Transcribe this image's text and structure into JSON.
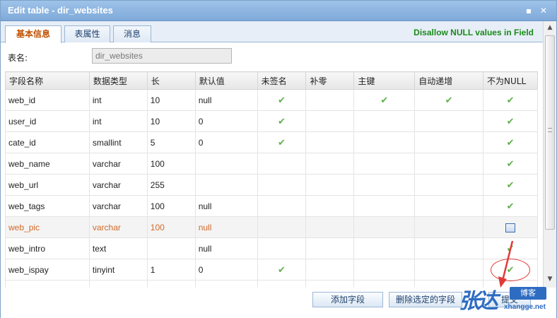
{
  "window": {
    "title": "Edit table - dir_websites"
  },
  "tabs": [
    {
      "label": "基本信息",
      "active": true
    },
    {
      "label": "表属性",
      "active": false
    },
    {
      "label": "消息",
      "active": false
    }
  ],
  "notice": "Disallow NULL values in Field",
  "table_name": {
    "label": "表名:",
    "value": "dir_websites"
  },
  "columns": [
    "字段名称",
    "数据类型",
    "长",
    "默认值",
    "未签名",
    "补零",
    "主键",
    "自动递增",
    "不为NULL"
  ],
  "rows": [
    {
      "name": "web_id",
      "type": "int",
      "length": "10",
      "default": "null",
      "unsigned": true,
      "zerofill": false,
      "pk": true,
      "ai": true,
      "notnull": "check"
    },
    {
      "name": "user_id",
      "type": "int",
      "length": "10",
      "default": "0",
      "unsigned": true,
      "zerofill": false,
      "pk": false,
      "ai": false,
      "notnull": "check"
    },
    {
      "name": "cate_id",
      "type": "smallint",
      "length": "5",
      "default": "0",
      "unsigned": true,
      "zerofill": false,
      "pk": false,
      "ai": false,
      "notnull": "check"
    },
    {
      "name": "web_name",
      "type": "varchar",
      "length": "100",
      "default": "",
      "unsigned": false,
      "zerofill": false,
      "pk": false,
      "ai": false,
      "notnull": "check"
    },
    {
      "name": "web_url",
      "type": "varchar",
      "length": "255",
      "default": "",
      "unsigned": false,
      "zerofill": false,
      "pk": false,
      "ai": false,
      "notnull": "check"
    },
    {
      "name": "web_tags",
      "type": "varchar",
      "length": "100",
      "default": "null",
      "unsigned": false,
      "zerofill": false,
      "pk": false,
      "ai": false,
      "notnull": "check"
    },
    {
      "name": "web_pic",
      "type": "varchar",
      "length": "100",
      "default": "null",
      "unsigned": false,
      "zerofill": false,
      "pk": false,
      "ai": false,
      "notnull": "checkbox"
    },
    {
      "name": "web_intro",
      "type": "text",
      "length": "",
      "default": "null",
      "unsigned": false,
      "zerofill": false,
      "pk": false,
      "ai": false,
      "notnull": "check"
    },
    {
      "name": "web_ispay",
      "type": "tinyint",
      "length": "1",
      "default": "0",
      "unsigned": true,
      "zerofill": false,
      "pk": false,
      "ai": false,
      "notnull": "check"
    },
    {
      "name": "",
      "type": "",
      "length": "",
      "default": "",
      "unsigned": false,
      "zerofill": false,
      "pk": false,
      "ai": false,
      "notnull": "none"
    }
  ],
  "buttons": {
    "add": "添加字段",
    "delete": "删除选定的字段",
    "submit": "提交"
  },
  "watermark": {
    "main": "张达",
    "badge": "博客",
    "url": "xhangge.net"
  },
  "colors": {
    "accent": "#7fa9d8",
    "check": "#5fb04a",
    "highlight_row_text": "#d06a2a",
    "annotation": "#e03a3a",
    "notice": "#1a8a1a"
  }
}
